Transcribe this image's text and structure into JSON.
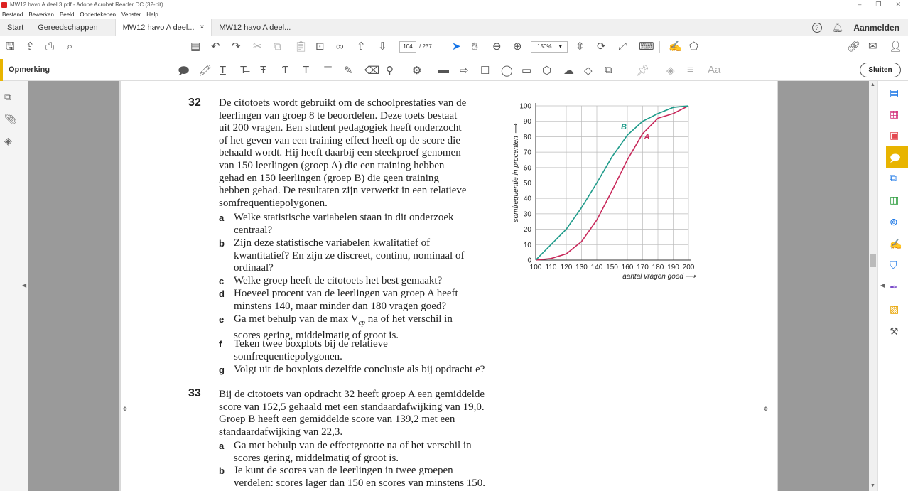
{
  "window": {
    "title": "MW12 havo A deel 3.pdf - Adobe Acrobat Reader DC (32-bit)",
    "minimize": "–",
    "maximize": "❐",
    "close": "✕"
  },
  "menu": [
    "Bestand",
    "Bewerken",
    "Beeld",
    "Ondertekenen",
    "Venster",
    "Help"
  ],
  "tabs": {
    "start": "Start",
    "tools": "Gereedschappen",
    "doc1": "MW12 havo A deel...",
    "doc2": "MW12 havo A deel..."
  },
  "header": {
    "help": "?",
    "signin": "Aanmelden"
  },
  "toolbar": {
    "page_current": "104",
    "page_total": "/ 237",
    "zoom": "150%"
  },
  "comment": {
    "label": "Opmerking",
    "close": "Sluiten",
    "text_tool": "Aa"
  },
  "doc": {
    "q32": {
      "num": "32",
      "lines": [
        "De citotoets wordt gebruikt om de schoolprestaties van de",
        "leerlingen van groep 8 te beoordelen. Deze toets bestaat",
        "uit 200 vragen. Een student pedagogiek heeft onderzocht",
        "of het geven van een training effect heeft op de score die",
        "behaald wordt. Hij heeft daarbij een steekproef genomen",
        "van 150 leerlingen (groep A) die een training hebben",
        "gehad en 150 leerlingen (groep B) die geen training",
        "hebben gehad. De resultaten zijn verwerkt in een relatieve",
        "somfrequentiepolygonen."
      ],
      "items": [
        {
          "letter": "a",
          "lines": [
            "Welke statistische variabelen staan in dit onderzoek",
            "centraal?"
          ]
        },
        {
          "letter": "b",
          "lines": [
            "Zijn deze statistische variabelen kwalitatief of",
            "kwantitatief? En zijn ze discreet, continu, nominaal of",
            "ordinaal?"
          ]
        },
        {
          "letter": "c",
          "lines": [
            "Welke groep heeft de citotoets het best gemaakt?"
          ]
        },
        {
          "letter": "d",
          "lines": [
            "Hoeveel procent van de leerlingen van groep A heeft",
            "minstens 140, maar minder dan 180 vragen goed?"
          ]
        },
        {
          "letter": "e",
          "lines": [
            "Ga met behulp van de max V",
            "scores gering, middelmatig of groot is."
          ],
          "sub": "cp",
          "rest": " na of het verschil in"
        },
        {
          "letter": "f",
          "lines": [
            "Teken twee boxplots bij de relatieve",
            "somfrequentiepolygonen."
          ]
        },
        {
          "letter": "g",
          "lines": [
            "Volgt uit de boxplots dezelfde conclusie als bij opdracht e?"
          ]
        }
      ]
    },
    "q33": {
      "num": "33",
      "lines": [
        "Bij de citotoets van opdracht 32 heeft groep A een gemiddelde",
        "score van 152,5 gehaald met een standaardafwijking van 19,0.",
        "Groep B heeft een gemiddelde score van 139,2 met een",
        "standaardafwijking van 22,3."
      ],
      "items": [
        {
          "letter": "a",
          "lines": [
            "Ga met behulp van de effectgrootte na of het verschil in",
            "scores gering, middelmatig of groot is."
          ]
        },
        {
          "letter": "b",
          "lines": [
            "Je kunt de scores van de leerlingen in twee groepen",
            "verdelen: scores lager dan 150 en scores van minstens 150."
          ]
        }
      ]
    }
  },
  "chart_data": {
    "type": "line",
    "xlabel": "aantal vragen goed",
    "ylabel": "somfrequentie in procenten",
    "xlim": [
      100,
      200
    ],
    "ylim": [
      0,
      100
    ],
    "x_ticks": [
      "100",
      "110",
      "120",
      "130",
      "140",
      "150",
      "160",
      "170",
      "180",
      "190",
      "200"
    ],
    "y_ticks": [
      "0",
      "10",
      "20",
      "30",
      "40",
      "50",
      "60",
      "70",
      "80",
      "90",
      "100"
    ],
    "grid": true,
    "series": [
      {
        "name": "A",
        "color": "#c8285a",
        "x": [
          100,
          110,
          120,
          130,
          140,
          150,
          160,
          170,
          180,
          190,
          200
        ],
        "y": [
          0,
          1,
          4,
          12,
          26,
          45,
          65,
          82,
          92,
          95,
          100
        ]
      },
      {
        "name": "B",
        "color": "#1e9b8a",
        "x": [
          100,
          110,
          120,
          130,
          140,
          150,
          160,
          170,
          180,
          190,
          200
        ],
        "y": [
          0,
          10,
          20,
          34,
          50,
          67,
          81,
          90,
          95,
          99,
          100
        ]
      }
    ]
  }
}
